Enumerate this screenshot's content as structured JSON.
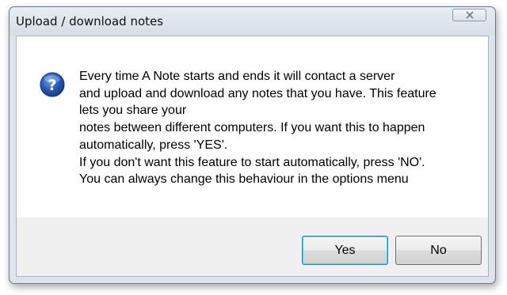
{
  "dialog": {
    "title": "Upload / download notes",
    "message_lines": [
      "Every time A Note starts and ends it will contact a server",
      "and upload and download any notes that you have. This feature",
      "lets you share your",
      "notes between different computers. If you want this to happen",
      "automatically, press 'YES'.",
      "If you don't want this feature to start automatically, press 'NO'.",
      "You can always change this behaviour in the options menu"
    ],
    "icon": "question-icon",
    "buttons": {
      "yes_label": "Yes",
      "no_label": "No"
    }
  },
  "colors": {
    "icon_blue": "#1f4fa8",
    "focus_border": "#3c7fb1",
    "frame": "#dde4ec"
  }
}
